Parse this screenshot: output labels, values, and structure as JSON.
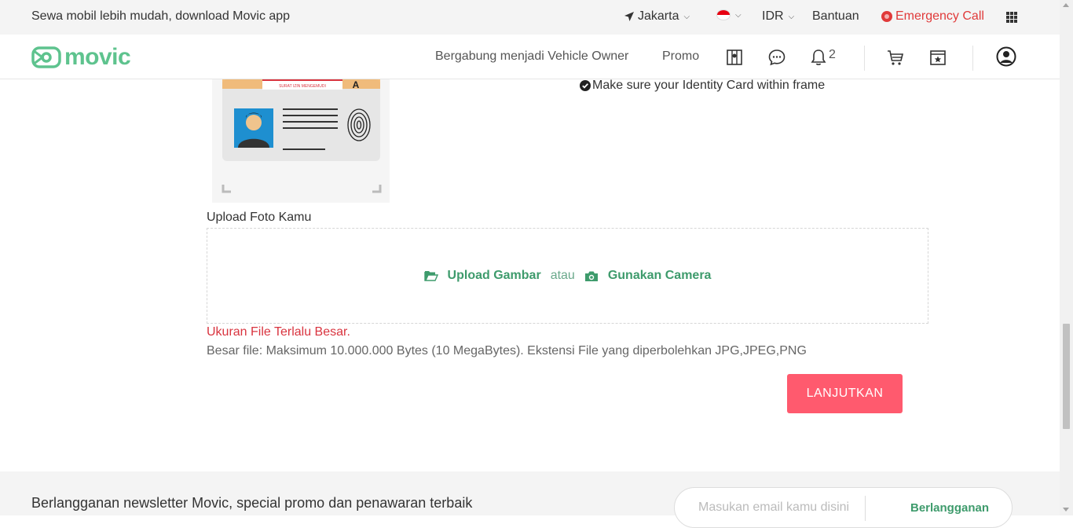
{
  "topbar": {
    "promo_text": "Sewa mobil lebih mudah, download Movic app",
    "location": "Jakarta",
    "currency": "IDR",
    "help": "Bantuan",
    "emergency": "Emergency Call"
  },
  "navbar": {
    "logo": "movic",
    "links": [
      "Bergabung menjadi Vehicle Owner",
      "Promo"
    ],
    "notification_count": "2",
    "icons": [
      "map-guide-icon",
      "chat-icon",
      "bell-icon",
      "cart-icon",
      "voucher-icon",
      "profile-icon"
    ]
  },
  "id_card": {
    "instruction": "Make sure your Identity Card within frame",
    "card_title": "SURAT IZIN MENGEMUDI",
    "card_class": "A"
  },
  "upload": {
    "label": "Upload Foto Kamu",
    "upload_image": "Upload Gambar",
    "or": "atau",
    "use_camera": "Gunakan Camera",
    "error": "Ukuran File Terlalu Besar.",
    "hint": "Besar file: Maksimum 10.000.000 Bytes (10 MegaBytes). Ekstensi File yang diperbolehkan JPG,JPEG,PNG",
    "submit": "LANJUTKAN"
  },
  "newsletter": {
    "text": "Berlangganan newsletter Movic, special promo dan penawaran terbaik",
    "placeholder": "Masukan email kamu disini",
    "button": "Berlangganan"
  },
  "colors": {
    "brand_green": "#5ec38e",
    "action_green": "#3e9b6c",
    "error_red": "#d9343f",
    "cta_pink": "#ff5a6e",
    "emergency_red": "#e03a3a"
  }
}
